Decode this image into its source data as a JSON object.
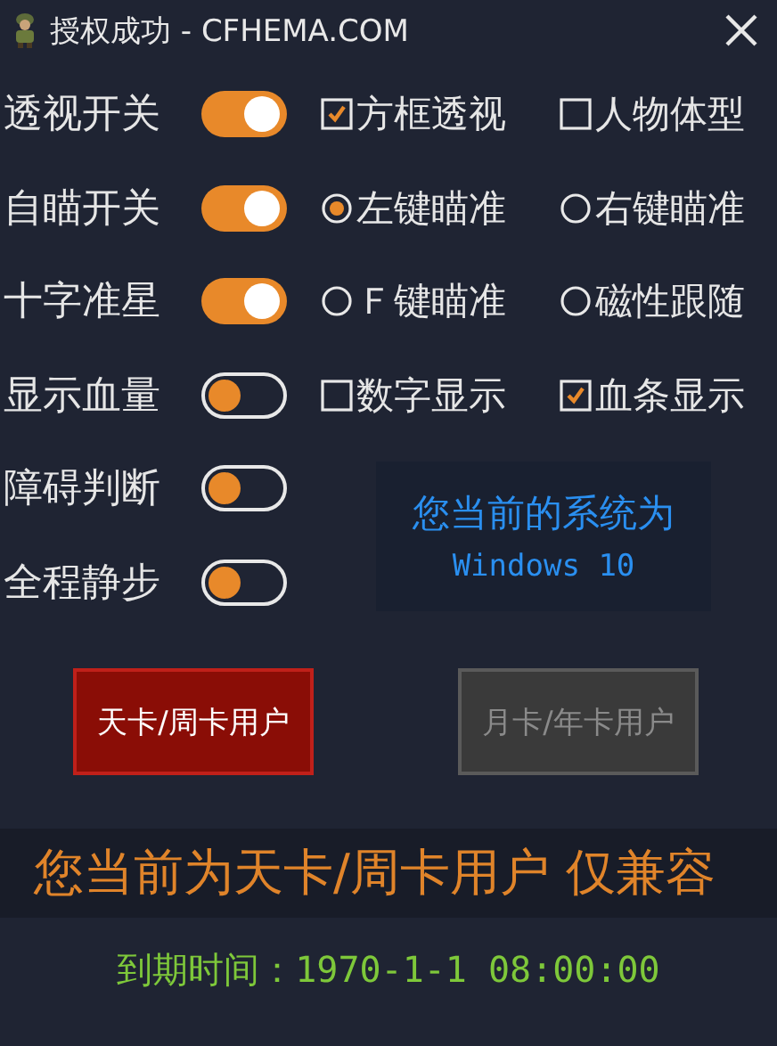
{
  "window": {
    "title": "授权成功 - CFHEMA.COM"
  },
  "features": [
    {
      "label": "透视开关",
      "on": true,
      "options": [
        {
          "kind": "checkbox",
          "label": "方框透视",
          "checked": true
        },
        {
          "kind": "checkbox",
          "label": "人物体型",
          "checked": false
        }
      ]
    },
    {
      "label": "自瞄开关",
      "on": true,
      "options": [
        {
          "kind": "radio",
          "label": "左键瞄准",
          "selected": true
        },
        {
          "kind": "radio",
          "label": "右键瞄准",
          "selected": false
        }
      ]
    },
    {
      "label": "十字准星",
      "on": true,
      "options": [
        {
          "kind": "radio",
          "label": "Ｆ键瞄准",
          "selected": false
        },
        {
          "kind": "radio",
          "label": "磁性跟随",
          "selected": false
        }
      ]
    },
    {
      "label": "显示血量",
      "on": false,
      "options": [
        {
          "kind": "checkbox",
          "label": "数字显示",
          "checked": false
        },
        {
          "kind": "checkbox",
          "label": "血条显示",
          "checked": true
        }
      ]
    },
    {
      "label": "障碍判断",
      "on": false
    },
    {
      "label": "全程静步",
      "on": false
    }
  ],
  "system_info": {
    "lines": [
      "您当前的系统为",
      "Windows 10"
    ]
  },
  "plan_buttons": [
    {
      "label": "天卡/周卡用户",
      "selected": true
    },
    {
      "label": "月卡/年卡用户",
      "selected": false
    }
  ],
  "banner": "您当前为天卡/周卡用户 仅兼容",
  "expiry": "到期时间：1970-1-1 08:00:00"
}
